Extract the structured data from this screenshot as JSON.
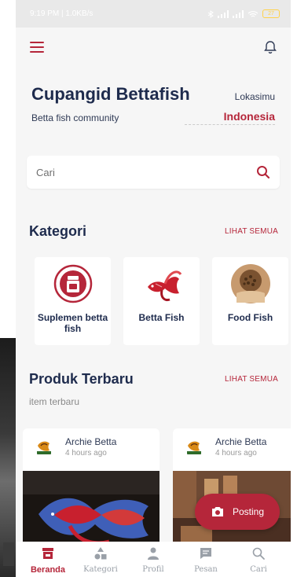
{
  "status_bar": {
    "left_text": "9:19 PM | 1.0KB/s",
    "battery": "27"
  },
  "header": {
    "title": "Cupangid Bettafish",
    "subtitle": "Betta fish community",
    "location_label": "Lokasimu",
    "location_value": "Indonesia"
  },
  "search": {
    "placeholder": "Cari"
  },
  "categories": {
    "title": "Kategori",
    "see_all": "LIHAT SEMUA",
    "items": [
      {
        "label": "Suplemen betta fish",
        "icon": "supplement-jar-icon"
      },
      {
        "label": "Betta Fish",
        "icon": "betta-fish-icon"
      },
      {
        "label": "Food Fish",
        "icon": "fish-food-icon"
      }
    ]
  },
  "newest": {
    "title": "Produk Terbaru",
    "subtitle": "item terbaru",
    "see_all": "LIHAT SEMUA",
    "items": [
      {
        "seller": "Archie Betta",
        "time": "4 hours ago"
      },
      {
        "seller": "Archie Betta",
        "time": "4 hours ago"
      }
    ]
  },
  "fab": {
    "label": "Posting",
    "icon": "camera-icon"
  },
  "bottom_nav": {
    "items": [
      {
        "label": "Beranda",
        "icon": "store-icon",
        "active": true
      },
      {
        "label": "Kategori",
        "icon": "shapes-icon",
        "active": false
      },
      {
        "label": "Profil",
        "icon": "person-icon",
        "active": false
      },
      {
        "label": "Pesan",
        "icon": "message-icon",
        "active": false
      },
      {
        "label": "Cari",
        "icon": "search-icon",
        "active": false
      }
    ]
  },
  "colors": {
    "accent": "#b5263a",
    "title": "#1e2b4d",
    "background": "#f6f6f6"
  }
}
